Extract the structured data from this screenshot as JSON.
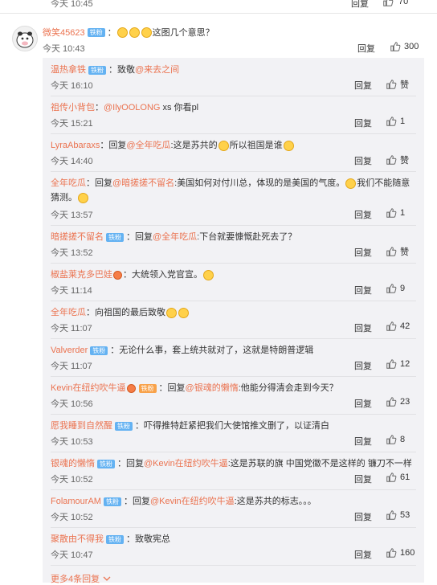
{
  "top_partial": {
    "time": "今天 10:45",
    "reply_label": "回复",
    "likes": "70"
  },
  "main_comment": {
    "user": "微笑45623",
    "badge": "铁粉",
    "text": "这图几个意思？",
    "time": "今天 10:43",
    "reply_label": "回复",
    "likes": "300"
  },
  "replies": [
    {
      "user": "温热拿铁",
      "badge": "铁粉",
      "text_pre": "：致敬",
      "mention": "@来去之间",
      "text_post": "",
      "time": "今天 16:10",
      "reply_label": "回复",
      "likes": "赞"
    },
    {
      "user": "祖传小背包",
      "badge": "",
      "text_pre": "：",
      "mention": "@IlyOOLONG",
      "text_post": " xs 你看pl",
      "time": "今天 15:21",
      "reply_label": "回复",
      "likes": "1"
    },
    {
      "user": "LyraAbaraxs",
      "badge": "",
      "text_pre": "：回复",
      "mention": "@全年吃瓜",
      "text_post": ":这是苏共的",
      "text_post2": "所以祖国是谁",
      "time": "今天 14:40",
      "reply_label": "回复",
      "likes": "赞"
    },
    {
      "user": "全年吃瓜",
      "badge": "",
      "text_pre": "：回复",
      "mention": "@暗搓搓不留名",
      "text_post": ":美国如何对付川总，体现的是美国的气度。",
      "text_post2": "我们不能随意猜测。",
      "time": "今天 13:57",
      "reply_label": "回复",
      "likes": "1"
    },
    {
      "user": "暗搓搓不留名",
      "badge": "铁粉",
      "text_pre": "：回复",
      "mention": "@全年吃瓜",
      "text_post": ":下台就要慷慨赴死去了？",
      "time": "今天 13:52",
      "reply_label": "回复",
      "likes": "赞"
    },
    {
      "user": "椒盐莱克多巴娃",
      "badge": "",
      "text_pre": "：大统领入党官宣。",
      "mention": "",
      "text_post": "",
      "time": "今天 11:14",
      "reply_label": "回复",
      "likes": "9"
    },
    {
      "user": "全年吃瓜",
      "badge": "",
      "text_pre": "：向祖国的最后致敬",
      "mention": "",
      "text_post": "",
      "time": "今天 11:07",
      "reply_label": "回复",
      "likes": "42"
    },
    {
      "user": "Valverder",
      "badge": "铁粉",
      "text_pre": "：无论什么事，套上统共就对了，这就是特朗普逻辑",
      "mention": "",
      "text_post": "",
      "time": "今天 11:07",
      "reply_label": "回复",
      "likes": "12"
    },
    {
      "user": "Kevin在纽约吹牛逼",
      "badge": "铁粉",
      "text_pre": "：回复",
      "mention": "@银魂的懒惰",
      "text_post": ":他能分得清会走到今天？",
      "time": "今天 10:56",
      "reply_label": "回复",
      "likes": "23"
    },
    {
      "user": "愿我睡到自然醒",
      "badge": "铁粉",
      "text_pre": "：吓得推特赶紧把我们大使馆推文删了，以证清白",
      "mention": "",
      "text_post": "",
      "time": "今天 10:53",
      "reply_label": "回复",
      "likes": "8"
    },
    {
      "user": "银魂的懒惰",
      "badge": "铁粉",
      "text_pre": "：回复",
      "mention": "@Kevin在纽约吹牛逼",
      "text_post": ":这是苏联的旗 中国党徽不是这样的 镰刀不一样",
      "time": "今天 10:52",
      "reply_label": "回复",
      "likes": "61"
    },
    {
      "user": "FolamourAM",
      "badge": "铁粉",
      "text_pre": "：回复",
      "mention": "@Kevin在纽约吹牛逼",
      "text_post": ":这是苏共的标志。。。",
      "time": "今天 10:52",
      "reply_label": "回复",
      "likes": "53"
    },
    {
      "user": "聚散由不得我",
      "badge": "铁粉",
      "text_pre": "：致敬宪总",
      "mention": "",
      "text_post": "",
      "time": "今天 10:47",
      "reply_label": "回复",
      "likes": "160"
    }
  ],
  "more_label": "更多4条回复",
  "colors": {
    "accent": "#eb7350",
    "badge": "#64b2f2",
    "panel_bg": "#f2f2f5"
  }
}
